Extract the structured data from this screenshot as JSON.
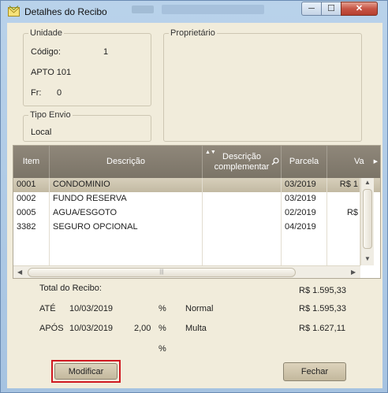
{
  "window": {
    "title": "Detalhes do Recibo",
    "minimize": "─",
    "maximize": "☐",
    "close": "✕"
  },
  "unidade": {
    "legend": "Unidade",
    "codigo_label": "Código:",
    "codigo_value": "1",
    "apto": "APTO 101",
    "fr_label": "Fr:",
    "fr_value": "0"
  },
  "proprietario": {
    "legend": "Proprietário"
  },
  "tipo_envio": {
    "legend": "Tipo Envio",
    "value": "Local"
  },
  "grid": {
    "columns": [
      "Item",
      "Descrição",
      "Descrição complementar",
      "Parcela",
      "Va"
    ],
    "rows": [
      {
        "item": "0001",
        "descricao": "CONDOMINIO",
        "complementar": "",
        "parcela": "03/2019",
        "valor": "R$ 1"
      },
      {
        "item": "0002",
        "descricao": "FUNDO RESERVA",
        "complementar": "",
        "parcela": "03/2019",
        "valor": ""
      },
      {
        "item": "0005",
        "descricao": "AGUA/ESGOTO",
        "complementar": "",
        "parcela": "02/2019",
        "valor": "R$"
      },
      {
        "item": "3382",
        "descricao": "SEGURO OPCIONAL",
        "complementar": "",
        "parcela": "04/2019",
        "valor": ""
      }
    ],
    "hscroll_grip": "|||"
  },
  "totais": {
    "total_label": "Total do Recibo:",
    "total_value": "R$ 1.595,33",
    "ate_label": "ATÉ",
    "ate_date": "10/03/2019",
    "ate_pct": "%",
    "ate_tipo": "Normal",
    "ate_value": "R$ 1.595,33",
    "apos_label": "APÓS",
    "apos_date": "10/03/2019",
    "apos_rate": "2,00",
    "apos_pct": "%",
    "apos_tipo": "Multa",
    "apos_value": "R$ 1.627,11",
    "extra_pct": "%"
  },
  "buttons": {
    "modificar": "Modificar",
    "fechar": "Fechar"
  }
}
